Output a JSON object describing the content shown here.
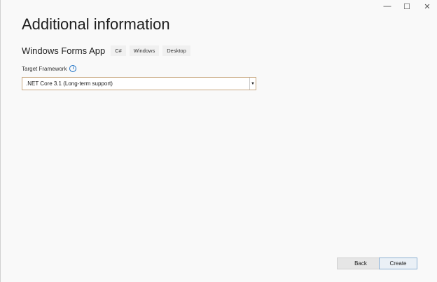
{
  "window": {
    "minimize": "—",
    "maximize": "☐",
    "close": "✕"
  },
  "title": "Additional information",
  "project": {
    "name": "Windows Forms App",
    "tags": [
      "C#",
      "Windows",
      "Desktop"
    ]
  },
  "framework": {
    "label": "Target Framework",
    "info_icon": "i",
    "value": ".NET Core 3.1 (Long-term support)",
    "arrow": "▼"
  },
  "buttons": {
    "back": "Back",
    "create": "Create"
  }
}
